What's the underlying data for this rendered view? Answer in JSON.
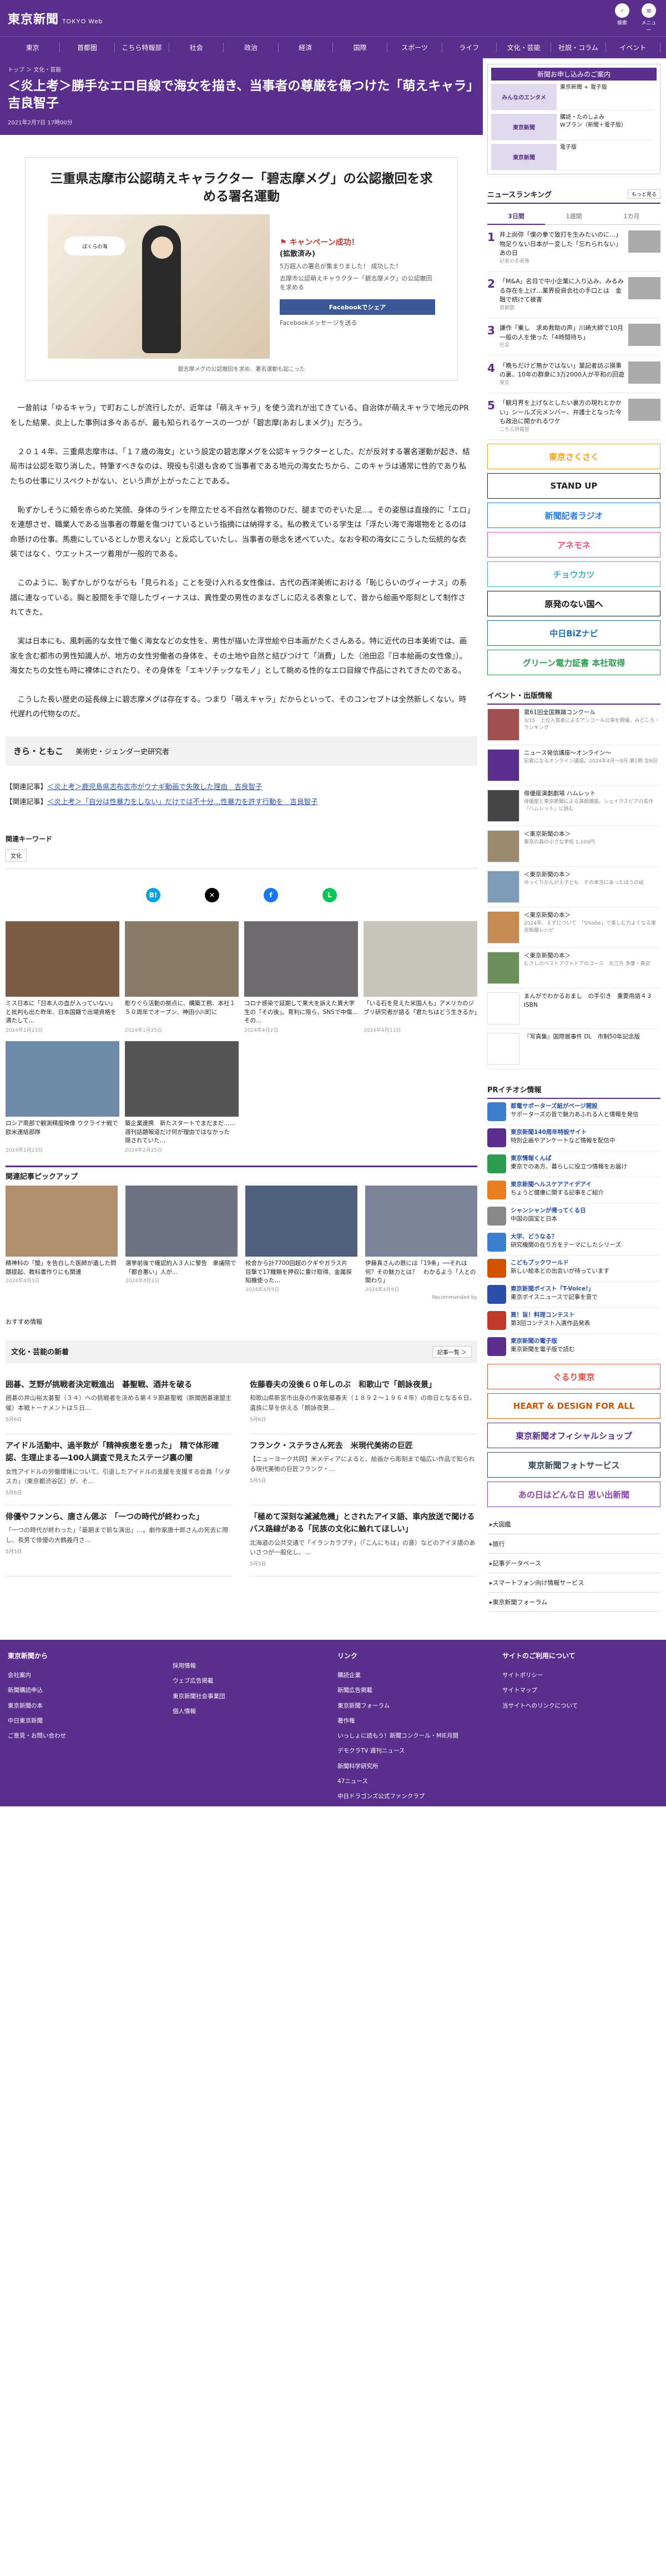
{
  "header": {
    "logo": "東京新聞",
    "logo_sub": "TOKYO Web",
    "icons": [
      {
        "name": "search-icon",
        "glyph": "⌕",
        "label": "検索"
      },
      {
        "name": "menu-icon",
        "glyph": "≡",
        "label": "メニュー"
      }
    ]
  },
  "nav": [
    "東京",
    "首都圏",
    "こちら特報部",
    "社会",
    "政治",
    "経済",
    "国際",
    "スポーツ",
    "ライフ",
    "文化・芸能",
    "社説・コラム",
    "イベント"
  ],
  "article": {
    "breadcrumb": "トップ ＞ 文化・芸能",
    "title": "＜炎上考＞勝手なエロ目線で海女を描き、当事者の尊厳を傷つけた「萌えキャラ」　吉良智子",
    "date": "2021年2月7日 17時00分",
    "image": {
      "headline": "三重県志摩市公認萌えキャラクター「碧志摩メグ」の公認撤回を求める署名運動",
      "bubble": "ぼくらの海",
      "campaign": "キャンペーン成功！",
      "campaign_sub": "(拡散済み)",
      "campaign_text": "5万超人の署名が集まりました！ 成功した！",
      "campaign_text2": "志摩市公認萌えキャラクター「碧志摩メグ」の公認撤回を求める",
      "fb": "Facebookでシェア",
      "fb2": "Facebookメッセージを送る",
      "caption": "碧志摩メグの公認撤回を求め、署名運動も起こった"
    },
    "paragraphs": [
      "一昔前は「ゆるキャラ」で町おこしが流行したが、近年は「萌えキャラ」を使う流れが出てきている。自治体が萌えキャラで地元のPRをした結果、炎上した事例は多々あるが、最も知られるケースの一つが「碧志摩(あおしまメグ)」だろう。",
      "２０１４年、三重県志摩市は、「１７歳の海女」という設定の碧志摩メグを公認キャラクターとした。だが反対する署名運動が起き、結局市は公認を取り消した。特筆すべきなのは、現役も引退も含めて当事者である地元の海女たちから、このキャラは通常に性的であり私たちの仕事にリスペクトがない、という声が上がったことである。",
      "恥ずかしそうに頬を赤らめた笑顔、身体のラインを際立たせる不自然な着物のひだ、腿までのぞいた足…。その姿態は直接的に「エロ」を連想させ、職業人である当事者の尊厳を傷つけているという指摘には納得する。私の教えている学生は「浮たい海で海堪物をとるのは命懸けの仕事。馬鹿にしているとしか思えない」と反応していたし、当事者の懸念を述べていた。なお令和の海女にこうした伝統的な衣装ではなく、ウエットスーツ着用が一般的である。",
      "このように、恥ずかしがりながらも「見られる」ことを受け入れる女性像は、古代の西洋美術における「恥じらいのヴィーナス」の系譜に連なっている。胸と股間を手で隠したヴィーナスは、異性愛の男性のまなざしに応える表象として、昔から絵画や彫刻として制作されてきた。",
      "実は日本にも、風刺画的な女性で働く海女などの女性を、男性が描いた浮世絵や日本画がたくさんある。特に近代の日本美術では、画家を含む都市の男性知識人が、地方の女性労働者の身体を、その土地や自然と結びつけて「消費」した（池田忍『日本絵画の女性像』）。海女たちの女性も時に裸体にされたり、その身体を「エキゾチックなモノ」として眺める性的なエロ目線で作品にされてきたのである。",
      "こうした長い歴史の延長線上に碧志摩メグは存在する。つまり「萌えキャラ」だからといって、そのコンセプトは全然新しくない。時代遅れの代物なのだ。"
    ],
    "author": {
      "name": "きら・ともこ",
      "role": "美術史・ジェンダー史研究者"
    },
    "related": [
      {
        "label": "【関連記事】",
        "link": "＜炎上考＞鹿児島県志布志市がウナギ動画で失敗した理由　吉良智子"
      },
      {
        "label": "【関連記事】",
        "link": "＜炎上考＞「自分は性暴力をしない」だけでは不十分…性暴力を許す行動を　吉良智子"
      }
    ],
    "keywords_title": "関連キーワード",
    "keyword": "文化"
  },
  "share": [
    {
      "name": "hatena-share-button",
      "glyph": "B!",
      "color": "#00a4de"
    },
    {
      "name": "x-share-button",
      "glyph": "✕",
      "color": "#000000"
    },
    {
      "name": "facebook-share-button",
      "glyph": "f",
      "color": "#1877f2"
    },
    {
      "name": "line-share-button",
      "glyph": "L",
      "color": "#06c755"
    }
  ],
  "cards": [
    {
      "t": "ミス日本に「日本人の血が入っていない」と批判も出た昨年、日本国籍で出場資格を満たして…",
      "d": "2024年1月23日",
      "c": "#7d5c46"
    },
    {
      "t": "彫りぐら活動の拠点に、構築工務、本社１５０周年でオープン、神田小川町に",
      "d": "2024年1月25日",
      "c": "#8a7a68"
    },
    {
      "t": "コロナ感染で延期して果大を訴えた異大学生の「その後」。育利に限ら、SNSで中傷…その…",
      "d": "2024年4月2日",
      "c": "#6f6a70"
    },
    {
      "t": "「いる石を見えた米国人も」アメリカのジブリ研究者が語る「君たちはどう生きるか」",
      "d": "2024年4月13日",
      "c": "#c9c4b8"
    },
    {
      "t": "ロシア南部で観測精度映像 ウクライナ戦で欧米連結部隊",
      "d": "2024年1月23日",
      "c": "#6f8aa8"
    },
    {
      "t": "築企業連携　新たスタートでまだまだ……週刊話題報道だけ何が理由ではなかった　隠されていた…",
      "d": "2024年2月25日",
      "c": "#555555"
    }
  ],
  "pickup": {
    "title": "関連記事ピックアップ",
    "items": [
      {
        "t": "精神科の「闇」を告白した医師が遺した問題提起、教科書作りにも関連",
        "d": "2024年4月3日",
        "c": "#b0906c"
      },
      {
        "t": "選挙前後で確認約入３人に警告　衆議院で「都合悪い」人が…",
        "d": "2024年4月2日",
        "c": "#6d7380"
      },
      {
        "t": "校舎から計7700回超のクギやガラス片　目撃で17種類を押収に重け取得、金属探知機使った…",
        "d": "2024年4月5日",
        "c": "#50607a"
      },
      {
        "t": "伊藤真さんの懸には「19条」──それは何？その魅力とは？　わかるよう「人との関わり」",
        "d": "2024年4月6日",
        "c": "#7a8496"
      }
    ],
    "recommended": "Recommended by"
  },
  "osusume": "おすすめ情報",
  "culture": {
    "title": "文化・芸能の新着",
    "more": "記事一覧 ＞",
    "items": [
      {
        "h": "囲碁、芝野が挑戦者決定戦進出　碁聖戦、酒井を破る",
        "p": "囲碁の井山裕太碁聖（３４）への挑戦者を決める第４９期碁聖戦（新聞囲碁連盟主催）本戦トーナメントは５日…",
        "d": "5月6日"
      },
      {
        "h": "佐藤春夫の没後６０年しのぶ　和歌山で「朗詠夜景」",
        "p": "和歌山県新宮市出身の作家佐藤春夫（１８９２～１９６４年）の命日となる６日、遺族に草を供える「朗詠夜景…",
        "d": "5月6日"
      },
      {
        "h": "アイドル活動中、過半数が「精神疾患を患った」　精で体形確認、生理止まる―100人調査で見えたステージ裏の闇",
        "p": "女性アイドルの労働環境について、引退したアイドルの支援を支援する会員「ソダスカ」（東京都渋谷区）が、そ…",
        "d": "5月6日"
      },
      {
        "h": "フランク・ステラさん死去　米現代美術の巨匠",
        "p": "【ニューヨーク共同】米メディアによると、絵画から彫刻まで幅広い作品で知られる現代美術の巨匠フランク・…",
        "d": "5月5日"
      },
      {
        "h": "俳優やファンら、唐さん偲ぶ　「一つの時代が終わった」",
        "p": "「一つの時代が終わった」「最期まで前な演出」…。劇作家唐十郎さんの死去に際し、長男で俳優の大鶴義丹さ…",
        "d": "5月5日"
      },
      {
        "h": "「極めて深刻な滅滅危機」とされたアイヌ語、車内放送で聞ける バス路線がある「民族の文化に触れてほしい」",
        "p": "北海道の公共交通で「イランカラプテ」（「こんにちは」の意）などのアイヌ語のあいさつが一般化し、…",
        "d": "5月5日"
      }
    ]
  },
  "sidebar": {
    "ad_header": "新聞お申し込みのご案内",
    "ads": [
      {
        "l": "みんなのエンタメ",
        "r": "東京新聞 + 電子版"
      },
      {
        "l": "東京新聞",
        "r": "購読・たのしよみ\nWプラン（新聞＋電子版）"
      },
      {
        "l": "東京新聞",
        "r": "電子版"
      }
    ],
    "ranking_title": "ニュースランキング",
    "ranking_more": "もっと見る",
    "tabs": [
      "3日間",
      "1週間",
      "1カ月"
    ],
    "ranking": [
      {
        "t": "井上尚弥「僕の拳で致打を生みたいのに…」　物足りない日本が一変した「忘れられない」あの日",
        "d": "記者の手紙等"
      },
      {
        "t": "「M&A」名目で中小企業に入り込み、みるみる存在を上げ…業界投資会社の手口とは　金融で続けて被害",
        "d": "首都圏"
      },
      {
        "t": "謙作「乗し　求め救助の声」川崎大師で10月一般の人を使った「4時間待ち」",
        "d": "社会"
      },
      {
        "t": "「晩ちだけど無かではない」葉記者訪ぶ損事の裏、10年の群衆に3万2000人が平和の回遊",
        "d": "東京"
      },
      {
        "t": "「観月界を上げなとしたい裏方の現れとかかい」シールズ元メンバー、弁護士となった今も政治に開かれるワケ",
        "d": "こちら特報部"
      }
    ],
    "banners": [
      {
        "t": "東京さくさく",
        "c": "#f6a20a"
      },
      {
        "t": "STAND UP",
        "c": "#222"
      },
      {
        "t": "新聞記者ラジオ",
        "c": "#2a7de1"
      },
      {
        "t": "アネモネ",
        "c": "#e3507a"
      },
      {
        "t": "チョウカツ",
        "c": "#3bb0c9"
      },
      {
        "t": "原発のない国へ",
        "c": "#111"
      },
      {
        "t": "中日BiZナビ",
        "c": "#1c6fb5"
      },
      {
        "t": "グリーン電力証書 本社取得",
        "c": "#2f9b4f"
      }
    ],
    "events_title": "イベント・出版情報",
    "events": [
      {
        "t": "第61回全国舞踊コンクール",
        "d": "3/15　上位入賞者によるアンコール公演を開催。みどころ・ランキング",
        "c": "#a05050"
      },
      {
        "t": "ニュース発信講座～オンライン～",
        "d": "記者になるオンライン講座。2024年4月～9月 第1期 全6回",
        "c": "#5a2e8c"
      },
      {
        "t": "俳優座演劇劇場 ハムレット",
        "d": "俳優座と東京新聞による演劇講座。シェイクスピアの名作『ハムレット』に挑む",
        "c": "#444"
      },
      {
        "t": "＜東京新聞の本＞",
        "d": "東京の森の小さな学校 1,100円",
        "c": "#9c8a6e"
      },
      {
        "t": "＜東京新聞の本＞",
        "d": "ゆっくりかんがえ子ども　その本当にあったほうの話",
        "c": "#7b9bb6"
      },
      {
        "t": "＜東京新聞の本＞",
        "d": "2024年、えずについて　「Shiabe」で楽しむ力よくなる東京新聞レシピ",
        "c": "#c48a52"
      },
      {
        "t": "＜東京新聞の本＞",
        "d": "むさしのベストアウトドアのコース　北三方 多摩・東京",
        "c": "#6b8e5a"
      },
      {
        "t": "まんがでわかるおまし　の手引き　重要用語４３　ISBN",
        "d": "",
        "c": "#ffffff"
      },
      {
        "t": "『写真集』国際展事件 DL　市制50年記念版",
        "d": "",
        "c": "#ffffff"
      }
    ],
    "pr_title": "PRイチオシ情報",
    "pr": [
      {
        "t": "都電サポーターズ紙がページ開設",
        "d": "サポーターズの皆で魅力あふれる人と情報を発信",
        "c": "#3c7fd0"
      },
      {
        "t": "東京新聞140周年特設サイト",
        "d": "特別企画やアンケートなど情報を配信中",
        "c": "#5a2e8c"
      },
      {
        "t": "東京情報くんぱ",
        "d": "東京でのあ方、暮らしに役立つ情報をお届け",
        "c": "#2f9b4f"
      },
      {
        "t": "東京新聞ヘルスケアアイデアイ",
        "d": "ちょうど健康に関する記事をご紹介",
        "c": "#e67e22"
      },
      {
        "t": "シャンシャンが帰ってくる日",
        "d": "中国の国宝と日本",
        "c": "#888"
      },
      {
        "t": "大学、どうなる？",
        "d": "研究機関の在り方をテーマにしたシリーズ",
        "c": "#3c7fd0"
      },
      {
        "t": "こどもブックワールド",
        "d": "新しい絵本との出会いが待っています",
        "c": "#d35400"
      },
      {
        "t": "東京新聞ボイスト「T-Voice!」",
        "d": "東京ボイスニュースで記事を音で",
        "c": "#2a4fa8"
      },
      {
        "t": "買！旨！料理コンテスト",
        "d": "第3回コンテスト入選作品発表",
        "c": "#c0392b"
      },
      {
        "t": "東京新聞の電子版",
        "d": "東京新聞を電子版で読む",
        "c": "#5a2e8c"
      }
    ],
    "banners2": [
      {
        "t": "ぐるり東京",
        "c": "#e74c3c"
      },
      {
        "t": "HEART & DESIGN FOR ALL",
        "c": "#d35400"
      },
      {
        "t": "東京新聞オフィシャルショップ",
        "c": "#5a2e8c"
      },
      {
        "t": "東京新聞フォトサービス",
        "c": "#34495e"
      },
      {
        "t": "あの日はどんな日 思い出新聞",
        "c": "#8e44ad"
      }
    ],
    "links": [
      "大図鑑",
      "旅行",
      "記事データベース",
      "スマートフォン向け情報サービス",
      "東京新聞フォーラム"
    ]
  },
  "footer": {
    "cols": [
      {
        "h": "東京新聞から",
        "items": [
          "会社案内",
          "新聞購読申込",
          "東京新聞の本",
          "中日東京新聞",
          "ご意見・お問い合わせ"
        ]
      },
      {
        "h": "",
        "items": [
          "採用情報",
          "ウェブ広告掲載",
          "東京新聞社会事業団",
          "個人情報"
        ]
      },
      {
        "h": "リンク",
        "items": [
          "購読企業",
          "新聞広告掲載",
          "東京新聞フォーラム",
          "著作権"
        ]
      },
      {
        "h": "サイトのご利用について",
        "items": [
          "サイトポリシー",
          "サイトマップ",
          "当サイトへのリンクについて"
        ]
      }
    ],
    "links": [
      "いっしょに読もう！新聞コンクール・MIE月間",
      "デモクラTV 週刊ニュース",
      "新聞科学研究所",
      "47ニュース",
      "中日ドラゴンズ公式ファンクラブ"
    ],
    "copyright": "Copyright © The Chunichi Shimbun, All rights reserved."
  }
}
